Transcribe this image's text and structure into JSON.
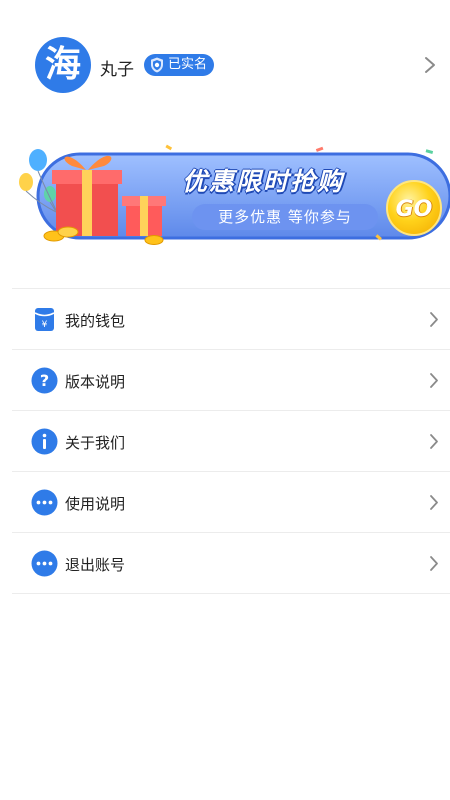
{
  "profile": {
    "avatar_char": "海",
    "username": "丸子",
    "verify_label": "已实名",
    "avatar_color": "#2f7be8"
  },
  "banner": {
    "title": "优惠限时抢购",
    "subtitle": "更多优惠  等你参与",
    "go_label": "GO"
  },
  "menu": {
    "items": [
      {
        "label": "我的钱包",
        "icon": "wallet-icon"
      },
      {
        "label": "版本说明",
        "icon": "question-circle-icon"
      },
      {
        "label": "关于我们",
        "icon": "info-circle-icon"
      },
      {
        "label": "使用说明",
        "icon": "more-circle-icon"
      },
      {
        "label": "退出账号",
        "icon": "more-circle-icon"
      }
    ]
  },
  "colors": {
    "accent": "#2f7be8",
    "divider": "#ececec",
    "chevron": "#8a8a8a"
  }
}
